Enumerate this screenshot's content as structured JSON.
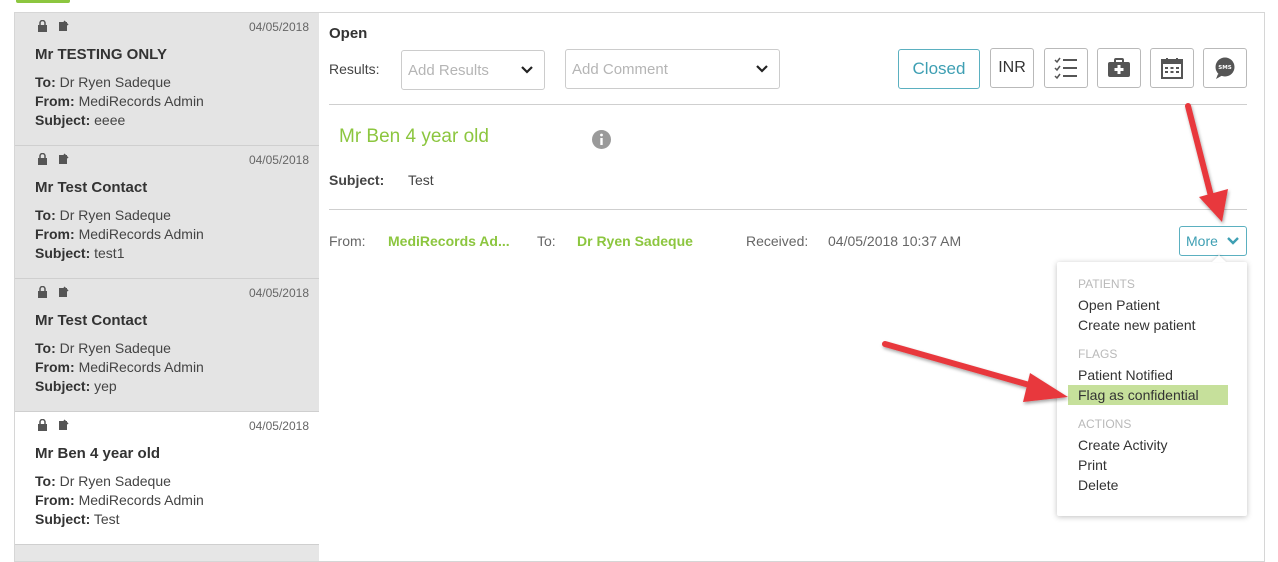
{
  "messages": [
    {
      "date": "04/05/2018",
      "name": "Mr TESTING ONLY",
      "to_label": "To:",
      "to": "Dr Ryen Sadeque",
      "from_label": "From:",
      "from": "MediRecords Admin",
      "subject_label": "Subject:",
      "subject": "eeee"
    },
    {
      "date": "04/05/2018",
      "name": "Mr Test Contact",
      "to_label": "To:",
      "to": "Dr Ryen Sadeque",
      "from_label": "From:",
      "from": "MediRecords Admin",
      "subject_label": "Subject:",
      "subject": "test1"
    },
    {
      "date": "04/05/2018",
      "name": "Mr Test Contact",
      "to_label": "To:",
      "to": "Dr Ryen Sadeque",
      "from_label": "From:",
      "from": "MediRecords Admin",
      "subject_label": "Subject:",
      "subject": "yep"
    },
    {
      "date": "04/05/2018",
      "name": "Mr Ben 4 year old",
      "to_label": "To:",
      "to": "Dr Ryen Sadeque",
      "from_label": "From:",
      "from": "MediRecords Admin",
      "subject_label": "Subject:",
      "subject": "Test"
    }
  ],
  "detail": {
    "status_title": "Open",
    "results_label": "Results:",
    "results_placeholder": "Add Results",
    "comment_placeholder": "Add Comment",
    "closed_button": "Closed",
    "inr_button": "INR",
    "patient_name": "Mr Ben 4 year old",
    "subject_label": "Subject:",
    "subject": "Test",
    "from_label": "From:",
    "from": "MediRecords Ad...",
    "to_label": "To:",
    "to": "Dr Ryen Sadeque",
    "received_label": "Received:",
    "received": "04/05/2018 10:37 AM",
    "more_button": "More"
  },
  "more_menu": {
    "patients_header": "PATIENTS",
    "open_patient": "Open Patient",
    "create_patient": "Create new patient",
    "flags_header": "FLAGS",
    "patient_notified": "Patient Notified",
    "flag_confidential": "Flag as confidential",
    "actions_header": "ACTIONS",
    "create_activity": "Create Activity",
    "print": "Print",
    "delete": "Delete"
  },
  "colors": {
    "accent_green": "#8cc63f",
    "accent_teal": "#3e9fb3",
    "highlight": "#c6e09b",
    "annotation_red": "#e8383d"
  },
  "icons": [
    "lock-icon",
    "note-icon",
    "checklist-icon",
    "medical-kit-icon",
    "calendar-icon",
    "sms-icon",
    "info-icon",
    "chevron-down-icon"
  ]
}
